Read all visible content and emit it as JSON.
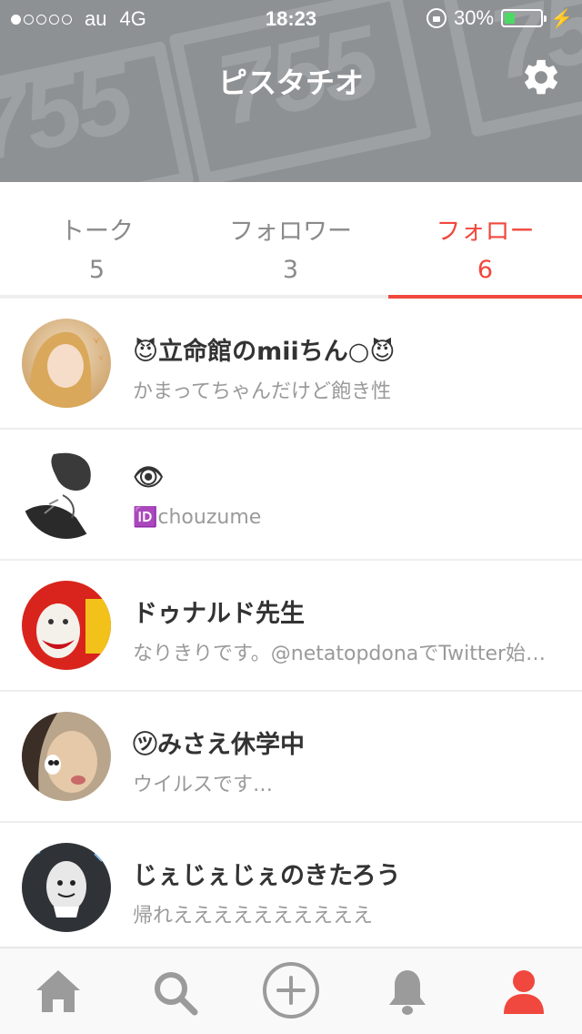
{
  "status_bar": {
    "carrier": "au",
    "network": "4G",
    "time": "18:23",
    "battery": "30%",
    "battery_level": 0.3,
    "battery_color": "#4cd964"
  },
  "header": {
    "title": "ピスタチオ",
    "background_color": "#8e9194",
    "background_pattern_text": "755"
  },
  "tabs": [
    {
      "label": "トーク",
      "count": "5",
      "active": false
    },
    {
      "label": "フォロワー",
      "count": "3",
      "active": false
    },
    {
      "label": "フォロー",
      "count": "6",
      "active": true
    }
  ],
  "accent_color": "#f0483e",
  "list": [
    {
      "name": "😈立命館のmiiちん○😈",
      "description": "かまってちゃんだけど飽き性",
      "avatar": "avatar-photo-blonde"
    },
    {
      "name": "👁",
      "description": "🆔chouzume",
      "avatar": "avatar-sketch"
    },
    {
      "name": "ドゥナルド先生",
      "description": "なりきりです。@netatopdonaでTwitter始めました",
      "avatar": "avatar-clown"
    },
    {
      "name": "㋡みさえ休学中",
      "description": "ウイルスです…",
      "avatar": "avatar-photo-face"
    },
    {
      "name": "じぇじぇじぇのきたろう",
      "description": "帰れええええええええええ",
      "avatar": "avatar-doodle"
    }
  ],
  "tabbar": [
    {
      "icon": "home-icon",
      "active": false
    },
    {
      "icon": "search-icon",
      "active": false
    },
    {
      "icon": "plus-circle-icon",
      "active": false
    },
    {
      "icon": "bell-icon",
      "active": false
    },
    {
      "icon": "person-icon",
      "active": true
    }
  ]
}
